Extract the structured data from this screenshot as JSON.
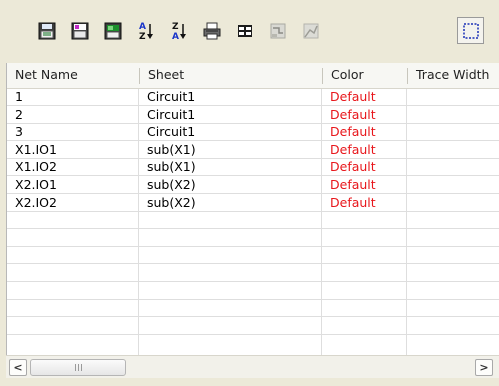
{
  "toolbar": {
    "buttons": [
      {
        "icon": "save-sheet-icon"
      },
      {
        "icon": "save-subcircuit-icon"
      },
      {
        "icon": "export-grid-icon"
      },
      {
        "icon": "sort-ascending-icon",
        "glyph_top": "A",
        "glyph_bottom": "Z"
      },
      {
        "icon": "sort-descending-icon",
        "glyph_top": "Z",
        "glyph_bottom": "A"
      },
      {
        "icon": "print-icon"
      },
      {
        "icon": "columns-icon"
      },
      {
        "icon": "trace-icon"
      },
      {
        "icon": "chart-icon"
      },
      {
        "icon": "select-region-icon"
      }
    ]
  },
  "table": {
    "headers": [
      "Net Name",
      "Sheet",
      "Color",
      "Trace Width"
    ],
    "rows": [
      {
        "net": "1",
        "sheet": "Circuit1",
        "color": "Default"
      },
      {
        "net": "2",
        "sheet": "Circuit1",
        "color": "Default"
      },
      {
        "net": "3",
        "sheet": "Circuit1",
        "color": "Default"
      },
      {
        "net": "X1.IO1",
        "sheet": "sub(X1)",
        "color": "Default"
      },
      {
        "net": "X1.IO2",
        "sheet": "sub(X1)",
        "color": "Default"
      },
      {
        "net": "X2.IO1",
        "sheet": "sub(X2)",
        "color": "Default"
      },
      {
        "net": "X2.IO2",
        "sheet": "sub(X2)",
        "color": "Default"
      }
    ],
    "empty_row_count": 7
  },
  "scrollbar": {
    "left_arrow": "<",
    "right_arrow": ">"
  },
  "colors": {
    "default_color_text": "#e8161b",
    "toolbar_bg": "#ece9d8"
  }
}
